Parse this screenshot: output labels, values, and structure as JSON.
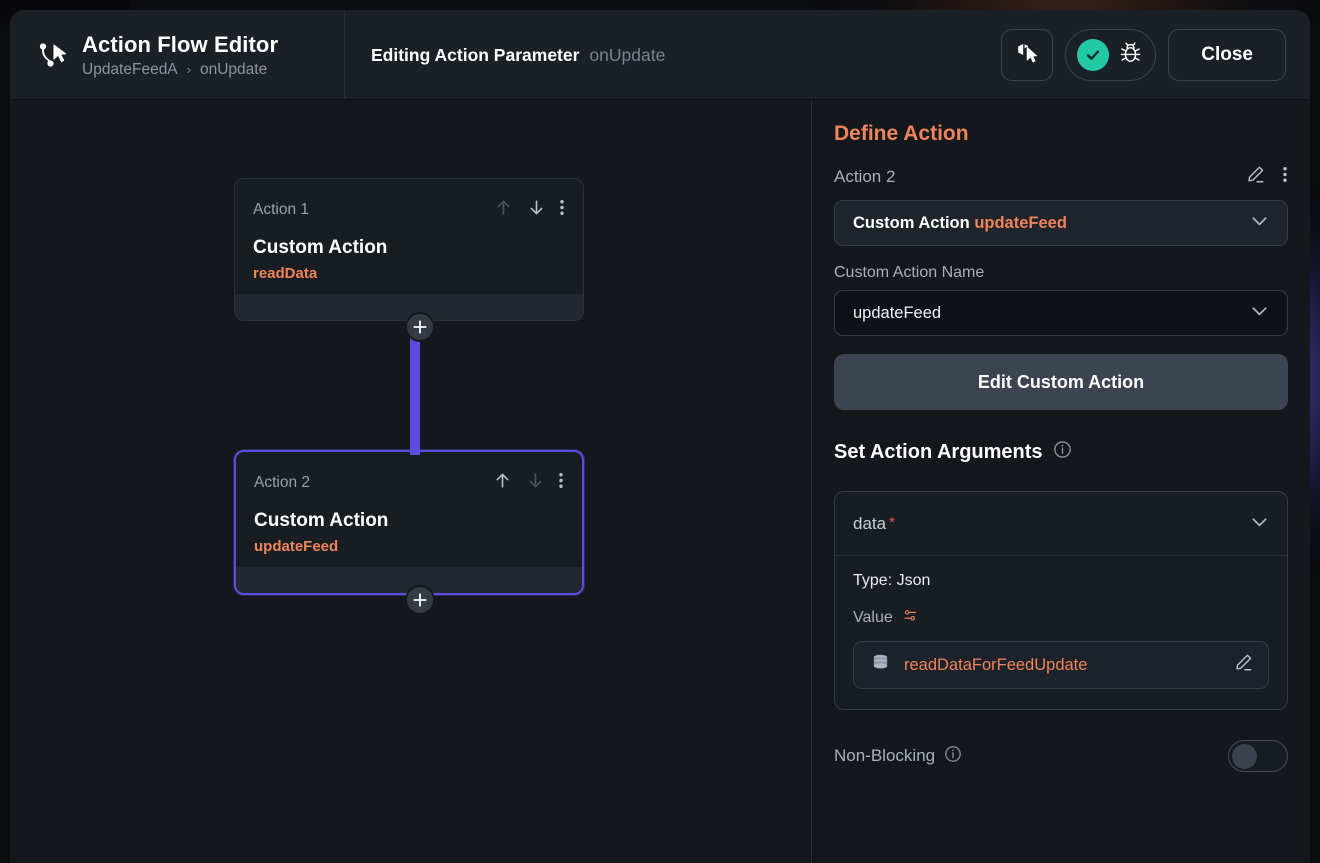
{
  "header": {
    "flow_icon": "action-flow-icon",
    "title": "Action Flow Editor",
    "breadcrumb": {
      "parent": "UpdateFeedA",
      "separator": "›",
      "current": "onUpdate"
    },
    "context": {
      "label": "Editing Action Parameter",
      "value": "onUpdate"
    },
    "actions": {
      "flow_tool_icon": "flow-cursor-icon",
      "status_icon": "check-icon",
      "debug_icon": "bug-icon",
      "close_label": "Close"
    },
    "accent_check_color": "#22c9a4"
  },
  "canvas": {
    "add_button_label": "+",
    "connector_color": "#5b4de0",
    "nodes": [
      {
        "index_label": "Action 1",
        "title": "Custom Action",
        "subtitle": "readData",
        "selected": false,
        "move_up_enabled": false,
        "move_down_enabled": true,
        "icons": {
          "up": "arrow-up-icon",
          "down": "arrow-down-icon",
          "menu": "kebab-menu-icon"
        }
      },
      {
        "index_label": "Action 2",
        "title": "Custom Action",
        "subtitle": "updateFeed",
        "selected": true,
        "move_up_enabled": true,
        "move_down_enabled": false,
        "icons": {
          "up": "arrow-up-icon",
          "down": "arrow-down-icon",
          "menu": "kebab-menu-icon"
        }
      }
    ]
  },
  "panel": {
    "heading": "Define Action",
    "accent_color": "#f0845a",
    "action_row": {
      "label": "Action 2",
      "edit_icon": "pencil-icon",
      "menu_icon": "kebab-menu-icon"
    },
    "action_type_select": {
      "prefix": "Custom Action",
      "value": "updateFeed",
      "chevron_icon": "chevron-down-icon"
    },
    "custom_action_name": {
      "label": "Custom Action Name",
      "value": "updateFeed",
      "chevron_icon": "chevron-down-icon"
    },
    "edit_custom_action_label": "Edit Custom Action",
    "arguments_section": {
      "heading": "Set Action Arguments",
      "info_icon": "info-icon",
      "argument": {
        "name": "data",
        "required_marker": "*",
        "chevron_icon": "chevron-down-icon",
        "type_line": "Type: Json",
        "value_label": "Value",
        "value_settings_icon": "sliders-icon",
        "chip": {
          "icon": "database-icon",
          "text": "readDataForFeedUpdate",
          "edit_icon": "pencil-icon"
        }
      }
    },
    "non_blocking": {
      "label": "Non-Blocking",
      "info_icon": "info-icon",
      "enabled": false
    }
  }
}
